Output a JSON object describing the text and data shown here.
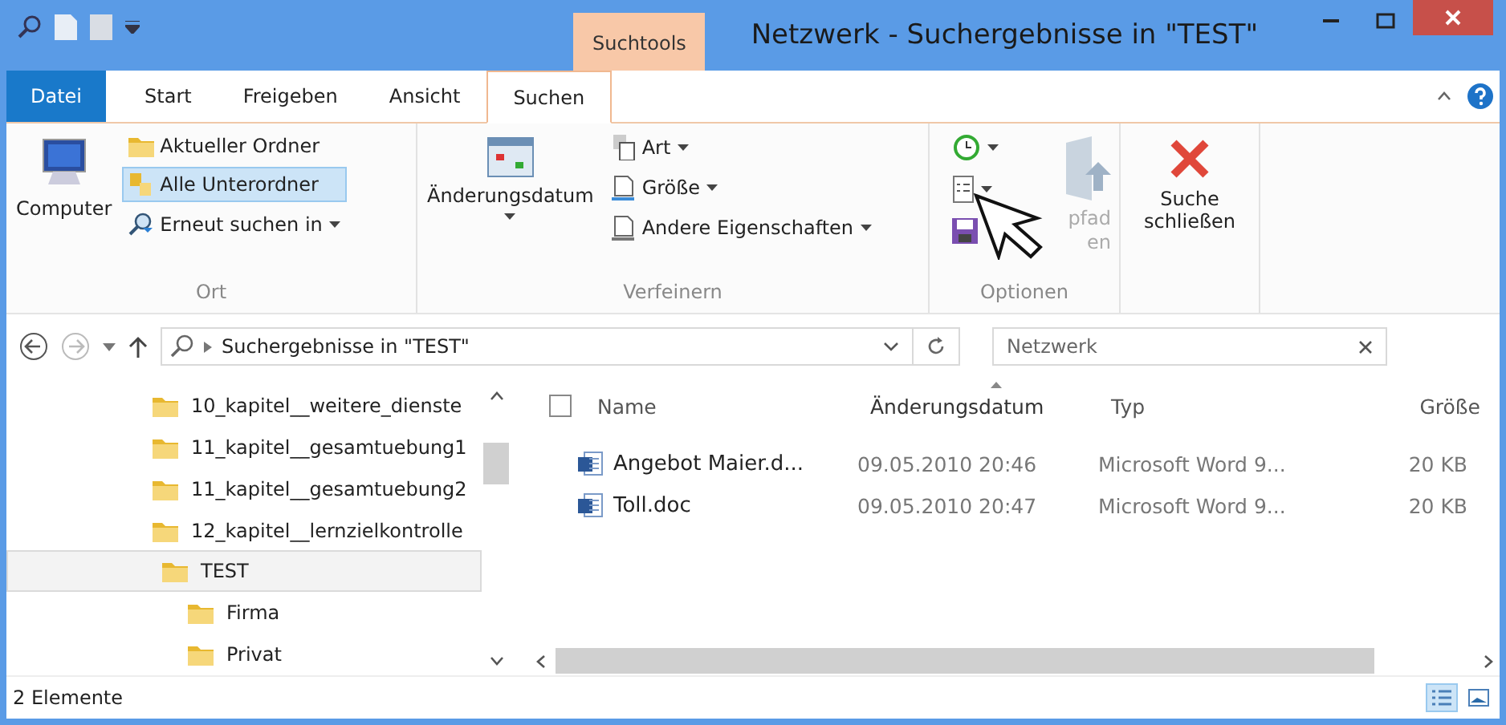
{
  "window": {
    "title": "Netzwerk - Suchergebnisse in \"TEST\""
  },
  "context_group": "Suchtools",
  "tabs": [
    {
      "label": "Datei",
      "kind": "file",
      "selected": false
    },
    {
      "label": "Start",
      "kind": "tab",
      "selected": false
    },
    {
      "label": "Freigeben",
      "kind": "tab",
      "selected": false
    },
    {
      "label": "Ansicht",
      "kind": "tab",
      "selected": false
    },
    {
      "label": "Suchen",
      "kind": "tab",
      "selected": true
    }
  ],
  "ribbon": {
    "ort": {
      "label": "Ort",
      "computer": "Computer",
      "items": [
        {
          "label": "Aktueller Ordner",
          "selected": false,
          "dropdown": false
        },
        {
          "label": "Alle Unterordner",
          "selected": true,
          "dropdown": false
        },
        {
          "label": "Erneut suchen in",
          "selected": false,
          "dropdown": true
        }
      ]
    },
    "verfeinern": {
      "label": "Verfeinern",
      "date_button": "Änderungsdatum",
      "items": [
        {
          "label": "Art",
          "kind": "type"
        },
        {
          "label": "Größe",
          "kind": "size"
        },
        {
          "label": "Andere Eigenschaften",
          "kind": "other"
        }
      ]
    },
    "optionen": {
      "label": "Optionen",
      "open_path": [
        "pfad",
        "en"
      ]
    },
    "close_search": [
      "Suche",
      "schließen"
    ]
  },
  "address": {
    "path": "Suchergebnisse in \"TEST\"",
    "search": "Netzwerk"
  },
  "tree": [
    {
      "label": "10_kapitel__weitere_dienste",
      "selected": false
    },
    {
      "label": "11_kapitel__gesamtuebung1",
      "selected": false
    },
    {
      "label": "11_kapitel__gesamtuebung2",
      "selected": false
    },
    {
      "label": "12_kapitel__lernzielkontrolle",
      "selected": false
    },
    {
      "label": "TEST",
      "selected": true,
      "children": [
        {
          "label": "Firma",
          "selected": false
        },
        {
          "label": "Privat",
          "selected": false
        }
      ]
    }
  ],
  "table": {
    "select_all": {
      "checked": false
    },
    "columns": [
      {
        "label": "Name",
        "sorted": false
      },
      {
        "label": "Änderungsdatum",
        "sorted": true
      },
      {
        "label": "Typ",
        "sorted": false
      },
      {
        "label": "Größe",
        "sorted": false
      }
    ],
    "rows": [
      [
        "Angebot Maier.d...",
        "09.05.2010 20:46",
        "Microsoft Word 9...",
        "20 KB"
      ],
      [
        "Toll.doc",
        "09.05.2010 20:47",
        "Microsoft Word 9...",
        "20 KB"
      ]
    ]
  },
  "status_bar": "2 Elemente",
  "views": [
    {
      "kind": "details",
      "selected": true
    },
    {
      "kind": "tiles",
      "selected": false
    }
  ]
}
